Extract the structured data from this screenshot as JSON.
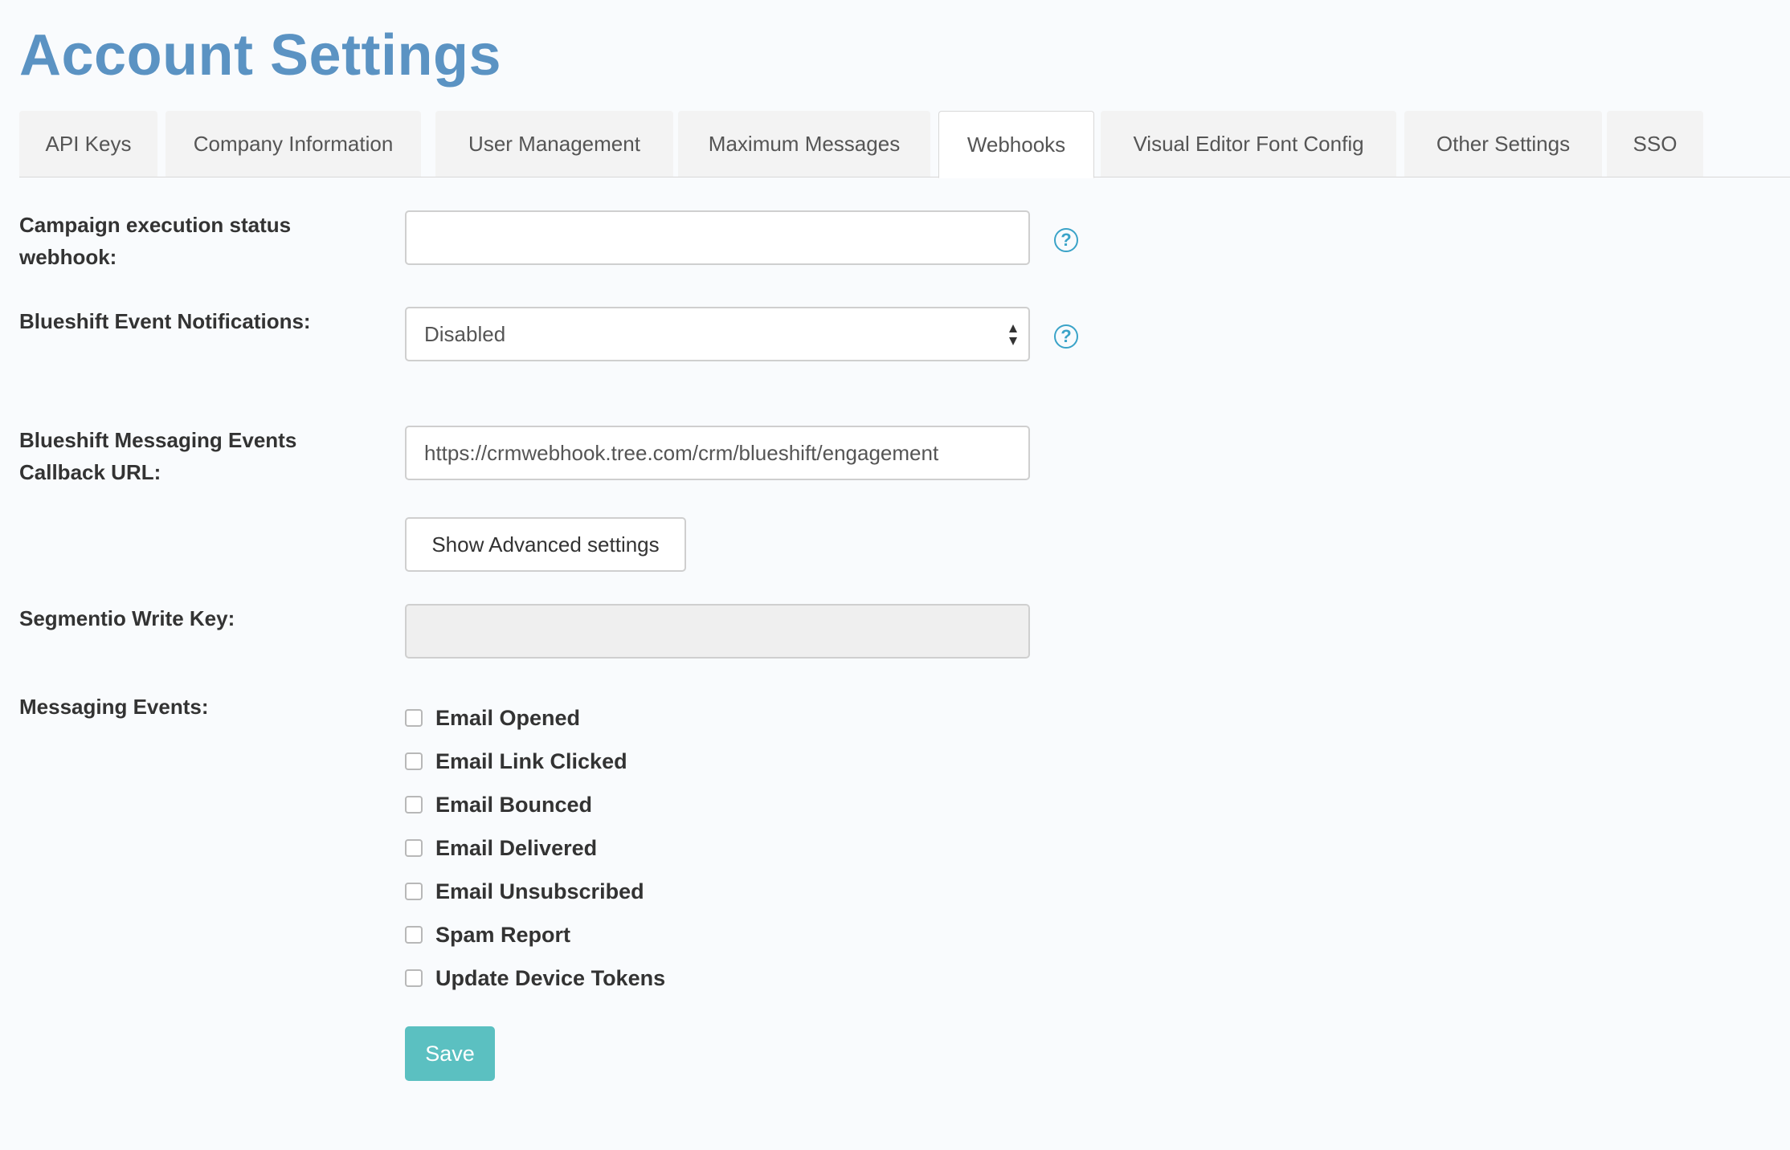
{
  "page_title": "Account Settings",
  "tabs": [
    {
      "label": "API Keys",
      "active": false
    },
    {
      "label": "Company Information",
      "active": false
    },
    {
      "label": "User Management",
      "active": false
    },
    {
      "label": "Maximum Messages",
      "active": false
    },
    {
      "label": "Webhooks",
      "active": true
    },
    {
      "label": "Visual Editor Font Config",
      "active": false
    },
    {
      "label": "Other Settings",
      "active": false
    },
    {
      "label": "SSO",
      "active": false
    }
  ],
  "form": {
    "campaign_webhook": {
      "label_line1": "Campaign execution status",
      "label_line2": "webhook:",
      "value": ""
    },
    "event_notifications": {
      "label": "Blueshift Event Notifications:",
      "selected": "Disabled"
    },
    "callback_url": {
      "label_line1": "Blueshift Messaging Events",
      "label_line2": "Callback URL:",
      "value": "https://crmwebhook.tree.com/crm/blueshift/engagement"
    },
    "advanced_button_label": "Show Advanced settings",
    "segment_key": {
      "label": "Segmentio Write Key:",
      "value": ""
    },
    "messaging_events": {
      "label": "Messaging Events:",
      "items": [
        {
          "label": "Email Opened",
          "checked": false
        },
        {
          "label": "Email Link Clicked",
          "checked": false
        },
        {
          "label": "Email Bounced",
          "checked": false
        },
        {
          "label": "Email Delivered",
          "checked": false
        },
        {
          "label": "Email Unsubscribed",
          "checked": false
        },
        {
          "label": "Spam Report",
          "checked": false
        },
        {
          "label": "Update Device Tokens",
          "checked": false
        }
      ]
    },
    "help_icon_glyph": "?",
    "save_label": "Save"
  },
  "colors": {
    "title": "#5b93c3",
    "help_icon": "#3aa3c8",
    "save_button": "#5bc0c1"
  }
}
